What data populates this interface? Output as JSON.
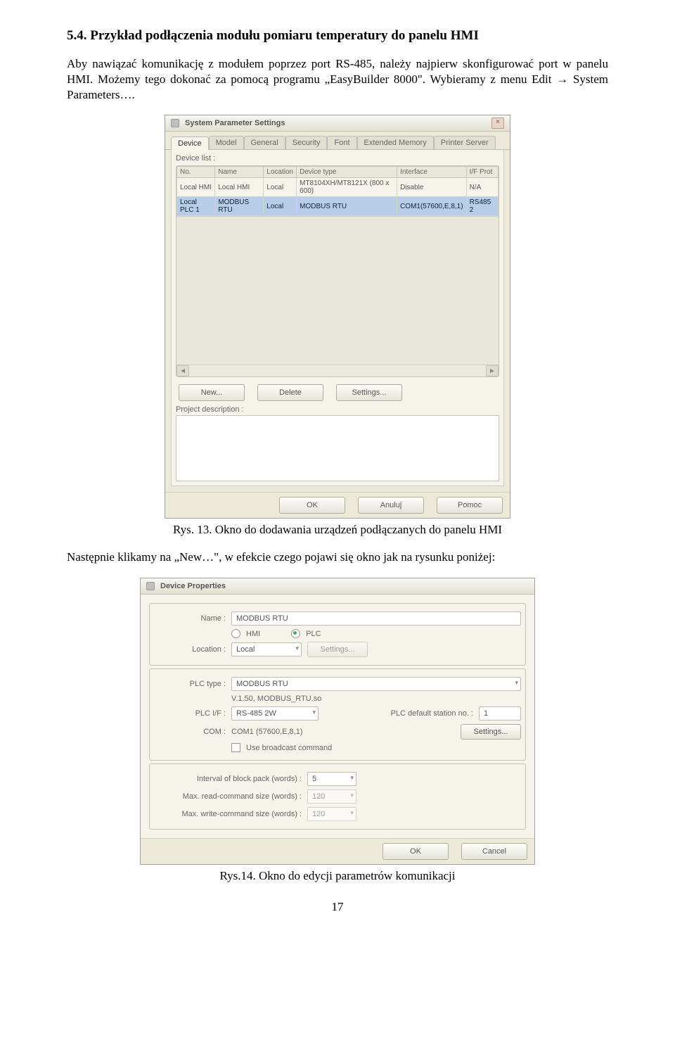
{
  "heading": "5.4. Przykład podłączenia modułu pomiaru temperatury do panelu HMI",
  "para1": "Aby nawiązać komunikację z modułem poprzez port RS-485, należy najpierw skonfigurować port w panelu HMI. Możemy tego dokonać za pomocą programu „EasyBuilder 8000\". Wybieramy z menu Edit → System Parameters….",
  "fig1": {
    "title": "System Parameter Settings",
    "tabs": [
      "Device",
      "Model",
      "General",
      "Security",
      "Font",
      "Extended Memory",
      "Printer Server"
    ],
    "list_label": "Device list :",
    "cols": [
      "No.",
      "Name",
      "Location",
      "Device type",
      "Interface",
      "I/F Prot"
    ],
    "rows": [
      [
        "Local HMI",
        "Local HMI",
        "Local",
        "MT8104XH/MT8121X (800 x 600)",
        "Disable",
        "N/A"
      ],
      [
        "Local PLC 1",
        "MODBUS RTU",
        "Local",
        "MODBUS RTU",
        "COM1(57600,E,8,1)",
        "RS485 2"
      ]
    ],
    "btn_new": "New...",
    "btn_delete": "Delete",
    "btn_settings": "Settings...",
    "desc_label": "Project description :",
    "ok": "OK",
    "apply": "Anuluj",
    "help": "Pomoc",
    "close_x": "×",
    "caption": "Rys. 13. Okno do dodawania urządzeń podłączanych do panelu HMI"
  },
  "para2": "Następnie klikamy na „New…\", w efekcie czego pojawi się okno jak na rysunku poniżej:",
  "fig2": {
    "title": "Device Properties",
    "name_label": "Name :",
    "name_val": "MODBUS RTU",
    "hmi": "HMI",
    "plc": "PLC",
    "loc_label": "Location :",
    "loc_val": "Local",
    "loc_settings": "Settings...",
    "plctype_label": "PLC type :",
    "plctype_val": "MODBUS RTU",
    "ver": "V.1.50, MODBUS_RTU.so",
    "plc_if_label": "PLC I/F :",
    "plc_if_val": "RS-485 2W",
    "defstn_label": "PLC default station no. :",
    "defstn_val": "1",
    "com_label": "COM :",
    "com_val": "COM1 (57600,E,8,1)",
    "com_settings": "Settings...",
    "bcast": "Use broadcast command",
    "interval_label": "Interval of block pack (words) :",
    "interval_val": "5",
    "maxr_label": "Max. read-command size (words) :",
    "maxr_val": "120",
    "maxw_label": "Max. write-command size (words) :",
    "maxw_val": "120",
    "ok": "OK",
    "cancel": "Cancel",
    "caption": "Rys.14. Okno do edycji parametrów komunikacji"
  },
  "pagenum": "17"
}
